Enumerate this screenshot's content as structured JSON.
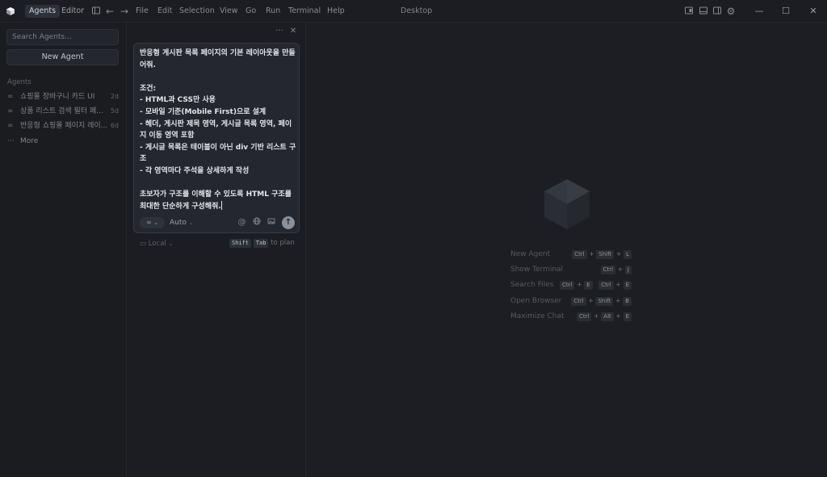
{
  "titlebar": {
    "tabs": [
      {
        "label": "Agents",
        "active": true
      },
      {
        "label": "Editor",
        "active": false
      }
    ],
    "menu": [
      "File",
      "Edit",
      "Selection",
      "View",
      "Go",
      "Run",
      "Terminal",
      "Help"
    ],
    "window_title": "Desktop"
  },
  "sidebar": {
    "search_placeholder": "Search Agents...",
    "new_agent_label": "New Agent",
    "section_label": "Agents",
    "items": [
      {
        "label": "쇼핑몰 장바구니 카드 UI",
        "age": "2d",
        "icon": "infinity-icon"
      },
      {
        "label": "상품 리스트 검색 필터 페...",
        "age": "5d",
        "icon": "infinity-icon"
      },
      {
        "label": "반응형 쇼핑몰 페이지 레이...",
        "age": "6d",
        "icon": "infinity-icon"
      }
    ],
    "more_label": "More"
  },
  "composer": {
    "prompt_text": "반응형 게시판 목록 페이지의 기본 레이아웃을 만들어줘.\n\n조건:\n- HTML과 CSS만 사용\n- 모바일 기준(Mobile First)으로 설계\n- 헤더, 게시판 제목 영역, 게시글 목록 영역, 페이지 이동 영역 포함\n- 게시글 목록은 테이블이 아닌 div 기반 리스트 구조\n- 각 영역마다 주석을 상세하게 작성\n\n초보자가 구조를 이해할 수 있도록 HTML 구조를 최대한 단순하게 구성해줘.",
    "mode_label": "Auto",
    "location_label": "Local",
    "plan_hint": {
      "key1": "Shift",
      "key2": "Tab",
      "text": "to plan"
    }
  },
  "shortcuts": [
    {
      "label": "New Agent",
      "keys": [
        "Ctrl",
        "Shift",
        "L"
      ]
    },
    {
      "label": "Show Terminal",
      "keys": [
        "Ctrl",
        "J"
      ]
    },
    {
      "label": "Search Files",
      "keys": [
        "Ctrl",
        "E",
        "Ctrl",
        "E"
      ]
    },
    {
      "label": "Open Browser",
      "keys": [
        "Ctrl",
        "Shift",
        "B"
      ]
    },
    {
      "label": "Maximize Chat",
      "keys": [
        "Ctrl",
        "Alt",
        "E"
      ]
    }
  ],
  "colors": {
    "background": "#1b1d22",
    "composer": "#24272d",
    "accent_send": "#8a9099"
  }
}
